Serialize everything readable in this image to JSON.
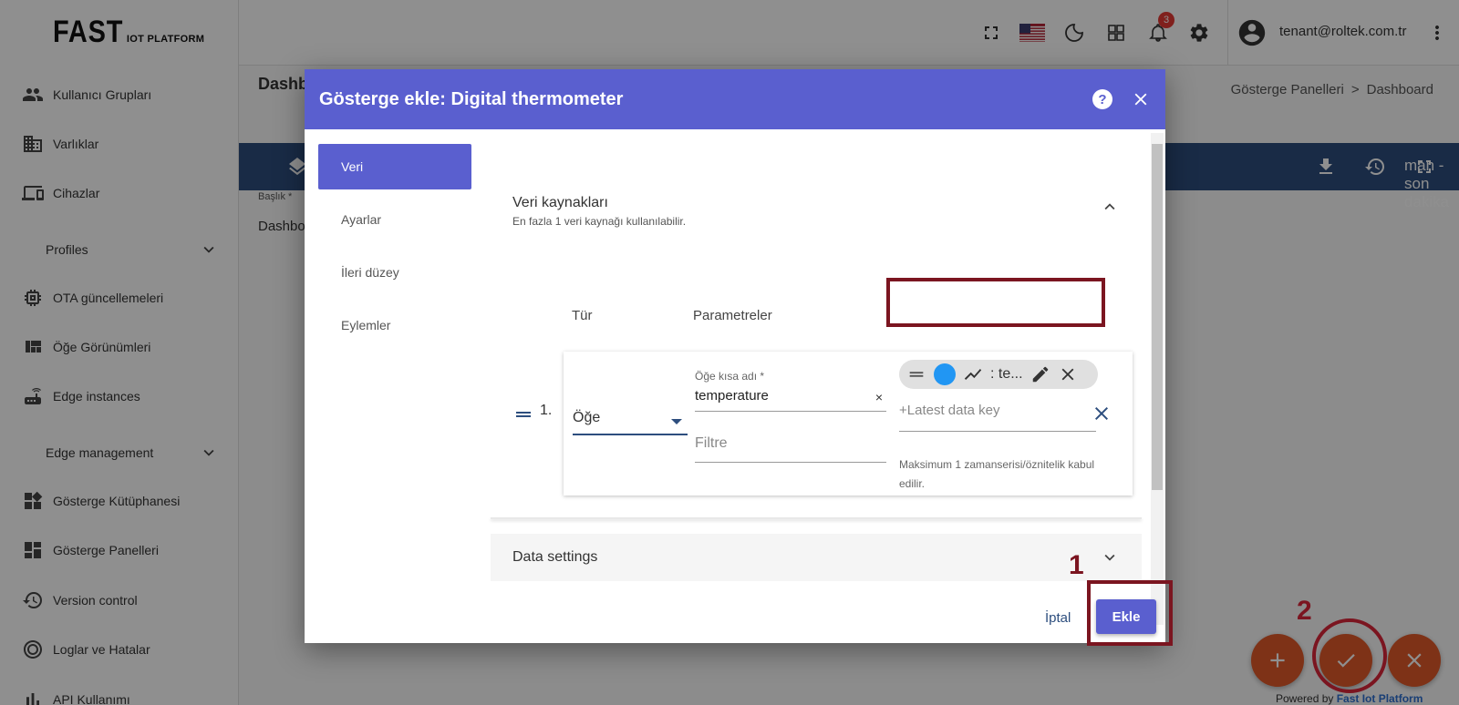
{
  "logo": {
    "big": "FAST",
    "small": "IOT PLATFORM"
  },
  "sidebar": {
    "items": [
      {
        "label": "Kullanıcı Grupları",
        "icon": "users-icon"
      },
      {
        "label": "Varlıklar",
        "icon": "building-icon"
      },
      {
        "label": "Cihazlar",
        "icon": "devices-icon"
      },
      {
        "label": "OTA güncellemeleri",
        "icon": "chip-icon"
      },
      {
        "label": "Öğe Görünümleri",
        "icon": "view-quilt-icon"
      },
      {
        "label": "Edge instances",
        "icon": "router-icon"
      },
      {
        "label": "Gösterge Kütüphanesi",
        "icon": "widgets-icon"
      },
      {
        "label": "Gösterge Panelleri",
        "icon": "dashboard-icon"
      },
      {
        "label": "Version control",
        "icon": "history-icon"
      },
      {
        "label": "Loglar ve Hatalar",
        "icon": "target-icon"
      },
      {
        "label": "API Kullanımı",
        "icon": "bar-chart-icon"
      }
    ],
    "groups": [
      {
        "label": "Profiles"
      },
      {
        "label": "Edge management"
      }
    ]
  },
  "topbar": {
    "notification_count": "3",
    "user_email": "tenant@roltek.com.tr"
  },
  "page": {
    "title": "Dashb",
    "breadcrumb": [
      "Gösterge Panelleri",
      ">",
      "Dashboard"
    ],
    "toolbar_text": "man - son dakika",
    "baslik_label": "Başlık *",
    "baslik_value": "Dashbo"
  },
  "dialog": {
    "title": "Gösterge ekle: Digital thermometer",
    "help_label": "?",
    "tabs": [
      "Veri",
      "Ayarlar",
      "İleri düzey",
      "Eylemler"
    ],
    "datasources": {
      "title": "Veri kaynakları",
      "subtitle": "En fazla 1 veri kaynağı kullanılabilir.",
      "col_type": "Tür",
      "col_params": "Parametreler",
      "row_number": "1.",
      "type_value": "Öğe",
      "alias_label": "Öğe kısa adı *",
      "alias_value": "temperature",
      "clear_symbol": "×",
      "filter_placeholder": "Filtre",
      "chip_text": ": te...",
      "chip_color": "#2196f3",
      "key_placeholder": "+Latest data key",
      "hint": "Maksimum 1 zamanserisi/öznitelik kabul edilir."
    },
    "data_settings": "Data settings",
    "cancel_label": "İptal",
    "add_label": "Ekle"
  },
  "annotations": {
    "one": "1",
    "two": "2"
  },
  "footer": {
    "powered_prefix": "Powered by ",
    "powered_brand": "Fast Iot Platform"
  },
  "colors": {
    "primary": "#5a5fcf",
    "toolbar": "#2d4e7e",
    "fab": "#e0592a",
    "annotation": "#7b1520"
  }
}
